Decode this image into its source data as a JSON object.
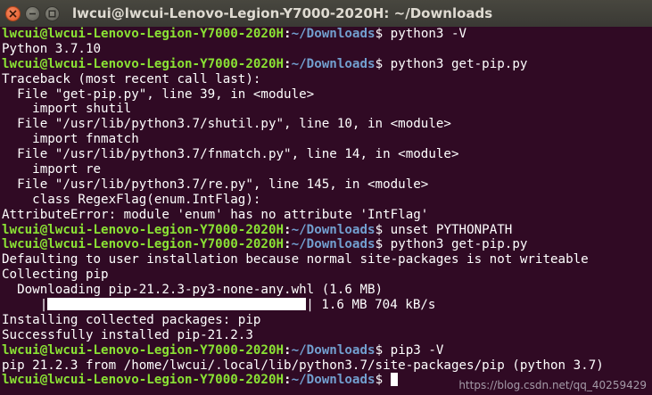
{
  "window": {
    "title": "lwcui@lwcui-Lenovo-Legion-Y7000-2020H: ~/Downloads",
    "buttons": [
      "close",
      "minimize",
      "maximize"
    ]
  },
  "prompt": {
    "user_host": "lwcui@lwcui-Lenovo-Legion-Y7000-2020H",
    "colon": ":",
    "path": "~/Downloads",
    "dollar": "$ "
  },
  "colors": {
    "background": "#300a24",
    "prompt_user": "#8ae234",
    "prompt_path": "#729fcf",
    "text": "#ffffff"
  },
  "lines": [
    {
      "type": "prompt",
      "cmd": "python3 -V"
    },
    {
      "type": "out",
      "text": "Python 3.7.10"
    },
    {
      "type": "prompt",
      "cmd": "python3 get-pip.py"
    },
    {
      "type": "out",
      "text": "Traceback (most recent call last):"
    },
    {
      "type": "out",
      "text": "  File \"get-pip.py\", line 39, in <module>"
    },
    {
      "type": "out",
      "text": "    import shutil"
    },
    {
      "type": "out",
      "text": "  File \"/usr/lib/python3.7/shutil.py\", line 10, in <module>"
    },
    {
      "type": "out",
      "text": "    import fnmatch"
    },
    {
      "type": "out",
      "text": "  File \"/usr/lib/python3.7/fnmatch.py\", line 14, in <module>"
    },
    {
      "type": "out",
      "text": "    import re"
    },
    {
      "type": "out",
      "text": "  File \"/usr/lib/python3.7/re.py\", line 145, in <module>"
    },
    {
      "type": "out",
      "text": "    class RegexFlag(enum.IntFlag):"
    },
    {
      "type": "out",
      "text": "AttributeError: module 'enum' has no attribute 'IntFlag'"
    },
    {
      "type": "prompt",
      "cmd": "unset PYTHONPATH"
    },
    {
      "type": "prompt",
      "cmd": "python3 get-pip.py"
    },
    {
      "type": "out",
      "text": "Defaulting to user installation because normal site-packages is not writeable"
    },
    {
      "type": "out",
      "text": "Collecting pip"
    },
    {
      "type": "out",
      "text": "  Downloading pip-21.2.3-py3-none-any.whl (1.6 MB)"
    },
    {
      "type": "progress",
      "prefix": "     |",
      "suffix": "| 1.6 MB 704 kB/s",
      "fraction": 1.0
    },
    {
      "type": "out",
      "text": "Installing collected packages: pip"
    },
    {
      "type": "out",
      "text": "Successfully installed pip-21.2.3"
    },
    {
      "type": "prompt",
      "cmd": "pip3 -V"
    },
    {
      "type": "out",
      "text": "pip 21.2.3 from /home/lwcui/.local/lib/python3.7/site-packages/pip (python 3.7)"
    },
    {
      "type": "prompt",
      "cmd": "",
      "cursor": true
    }
  ],
  "watermark": "https://blog.csdn.net/qq_40259429"
}
